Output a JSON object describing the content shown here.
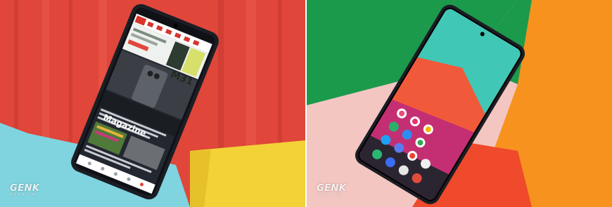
{
  "images": [
    {
      "description": "Phone lying face-up on red crepe paper showing a news app",
      "screen": {
        "magazine_label": "Magazine",
        "promo_label": "M31"
      },
      "watermark": {
        "logo": "GENK",
        "sub": "GENK.VN"
      }
    },
    {
      "description": "Phone lying face-up on green, orange and pink paper showing home screen",
      "watermark": {
        "logo": "GENK",
        "sub": "GENK.VN"
      }
    }
  ],
  "colors": {
    "red_paper": "#e2463b",
    "cyan_paper": "#7ad3df",
    "yellow_paper": "#f2d33a",
    "green_paper": "#1c9a4b",
    "orange_paper": "#f7921e",
    "pink_paper": "#f4c6c2",
    "phone_body": "#1b1e25"
  }
}
